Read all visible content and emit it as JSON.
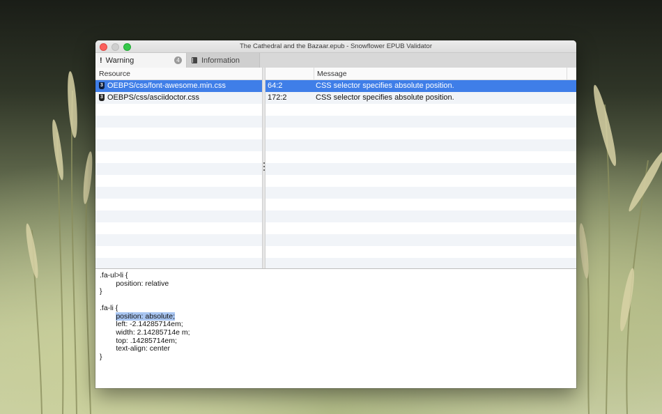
{
  "window": {
    "title": "The Cathedral and the Bazaar.epub - Snowflower EPUB Validator"
  },
  "tabs": [
    {
      "label": "Warning",
      "icon": "exclamation-icon",
      "badge": "4",
      "active": true
    },
    {
      "label": "Information",
      "icon": "book-icon",
      "active": false
    }
  ],
  "resource_table": {
    "header": "Resource",
    "rows": [
      {
        "icon": "css-file-icon",
        "name": "OEBPS/css/font-awesome.min.css",
        "selected": true
      },
      {
        "icon": "css-file-icon",
        "name": "OEBPS/css/asciidoctor.css",
        "selected": false
      }
    ]
  },
  "message_table": {
    "header_location": "",
    "header_message": "Message",
    "rows": [
      {
        "location": "64:2",
        "message": "CSS selector specifies absolute position.",
        "selected": true
      },
      {
        "location": "172:2",
        "message": "CSS selector specifies absolute position.",
        "selected": false
      }
    ]
  },
  "code": {
    "before": ".fa-ul>li {\n        position: relative\n}\n\n.fa-li {\n        ",
    "highlight": "position: absolute;",
    "after": "\n        left: -2.14285714em;\n        width: 2.14285714e m;\n        top: .14285714em;\n        text-align: center\n}"
  },
  "colors": {
    "selection": "#3f7ee8",
    "highlight": "#a9c6f2"
  }
}
